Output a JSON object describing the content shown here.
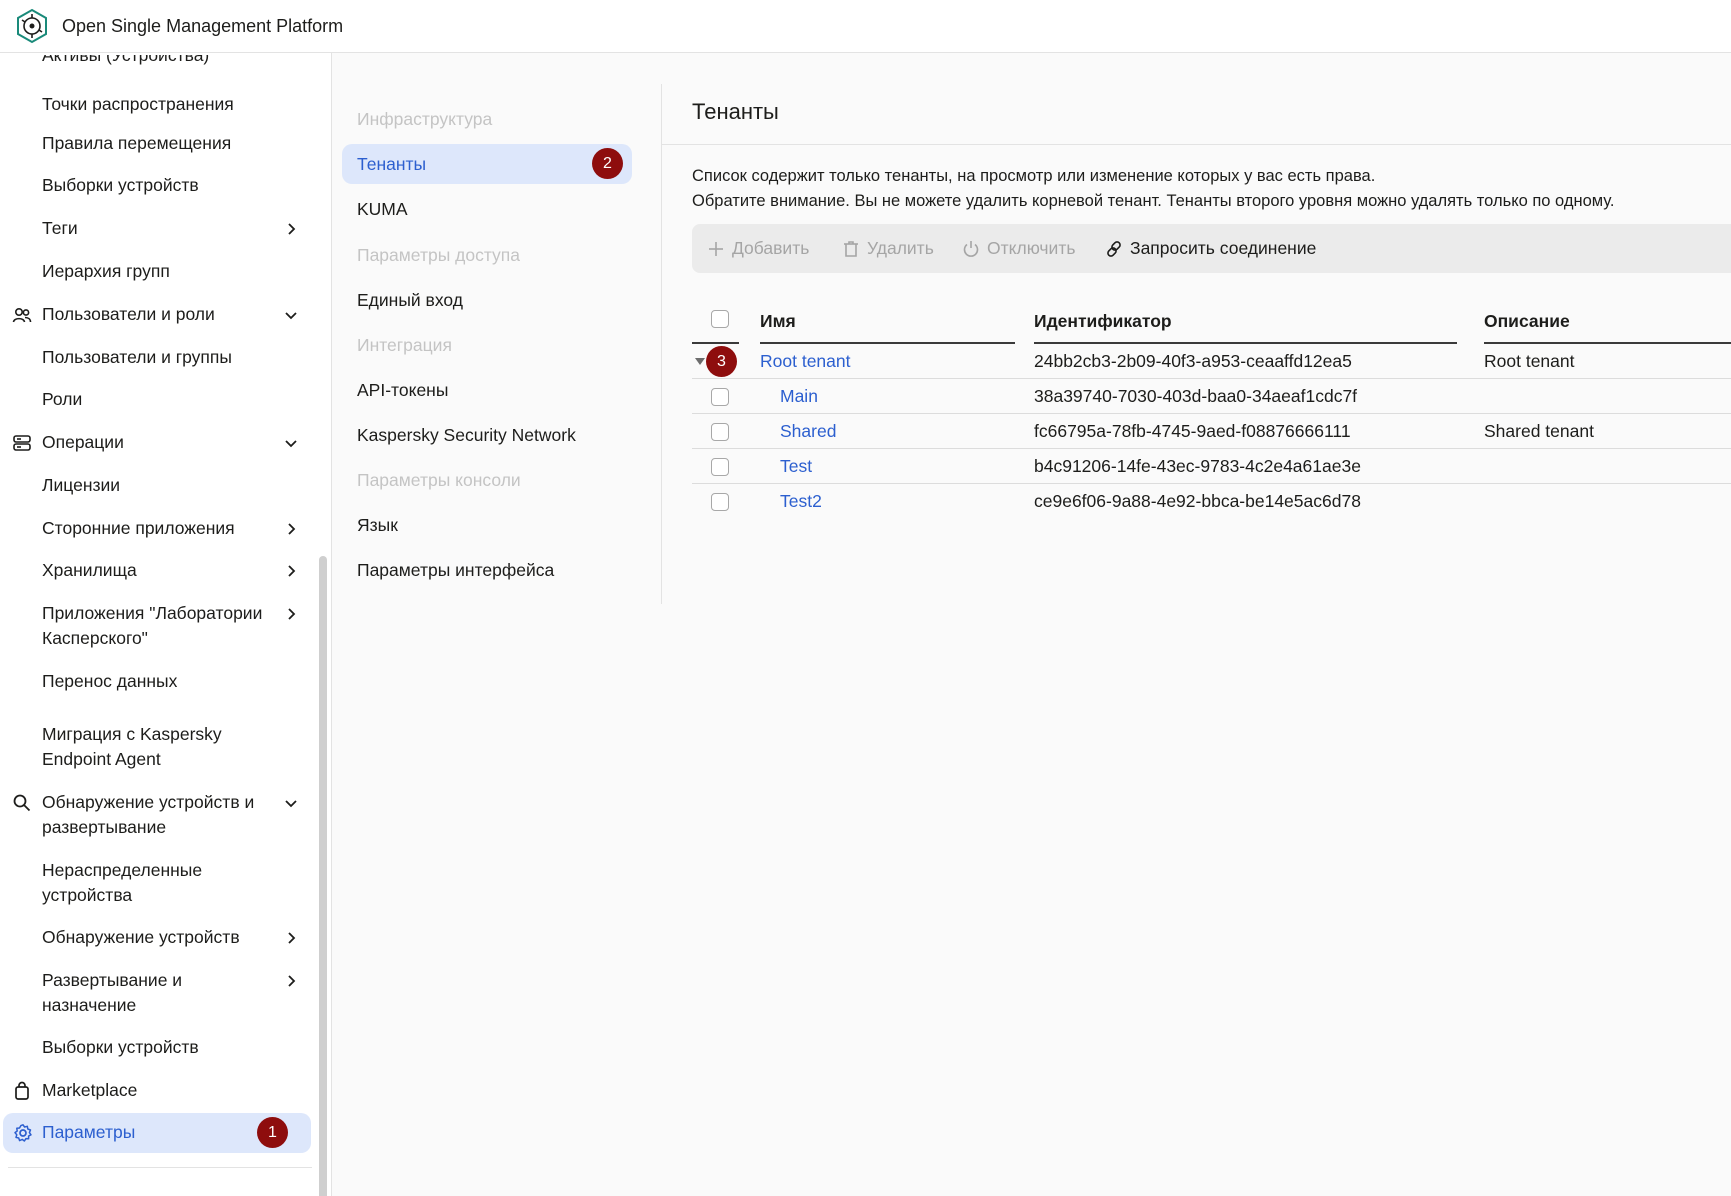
{
  "header": {
    "title": "Open Single Management Platform"
  },
  "sidebar": {
    "items": [
      {
        "label": "Активы (Устройства)"
      },
      {
        "label": "Точки распространения"
      },
      {
        "label": "Правила перемещения"
      },
      {
        "label": "Выборки устройств"
      },
      {
        "label": "Теги"
      },
      {
        "label": "Иерархия групп"
      },
      {
        "label": "Пользователи и роли"
      },
      {
        "label": "Пользователи и группы"
      },
      {
        "label": "Роли"
      },
      {
        "label": "Операции"
      },
      {
        "label": "Лицензии"
      },
      {
        "label": "Сторонние приложения"
      },
      {
        "label": "Хранилища"
      },
      {
        "label": "Приложения \"Лаборатории Касперского\""
      },
      {
        "label": "Перенос данных"
      },
      {
        "label": "Миграция с Kaspersky Endpoint Agent"
      },
      {
        "label": "Обнаружение устройств и развертывание"
      },
      {
        "label": "Нераспределенные устройства"
      },
      {
        "label": "Обнаружение устройств"
      },
      {
        "label": "Развертывание и назначение"
      },
      {
        "label": "Выборки устройств"
      },
      {
        "label": "Marketplace"
      },
      {
        "label": "Параметры",
        "badge": "1"
      }
    ]
  },
  "submenu": {
    "items": [
      {
        "label": "Инфраструктура"
      },
      {
        "label": "Тенанты",
        "badge": "2"
      },
      {
        "label": "KUMA"
      },
      {
        "label": "Параметры доступа"
      },
      {
        "label": "Единый вход"
      },
      {
        "label": "Интеграция"
      },
      {
        "label": "API-токены"
      },
      {
        "label": "Kaspersky Security Network"
      },
      {
        "label": "Параметры консоли"
      },
      {
        "label": "Язык"
      },
      {
        "label": "Параметры интерфейса"
      }
    ]
  },
  "main": {
    "title": "Тенанты",
    "description": [
      "Список содержит только тенанты, на просмотр или изменение которых у вас есть права.",
      "Обратите внимание. Вы не можете удалить корневой тенант. Тенанты второго уровня можно удалять только по одному."
    ],
    "toolbar": {
      "add": "Добавить",
      "delete": "Удалить",
      "disable": "Отключить",
      "request": "Запросить соединение"
    },
    "table": {
      "columns": [
        "Имя",
        "Идентификатор",
        "Описание"
      ],
      "rows": [
        {
          "name": "Root tenant",
          "id": "24bb2cb3-2b09-40f3-a953-ceaaffd12ea5",
          "description": "Root tenant",
          "badge": "3"
        },
        {
          "name": "Main",
          "id": "38a39740-7030-403d-baa0-34aeaf1cdc7f",
          "description": ""
        },
        {
          "name": "Shared",
          "id": "fc66795a-78fb-4745-9aed-f08876666111",
          "description": "Shared tenant"
        },
        {
          "name": "Test",
          "id": "b4c91206-14fe-43ec-9783-4c2e4a61ae3e",
          "description": ""
        },
        {
          "name": "Test2",
          "id": "ce9e6f06-9a88-4e92-bbca-be14e5ac6d78",
          "description": ""
        }
      ]
    }
  },
  "colors": {
    "accent": "#2c5fcf",
    "active_bg": "#dde7fb",
    "badge": "#8e0d0d"
  }
}
